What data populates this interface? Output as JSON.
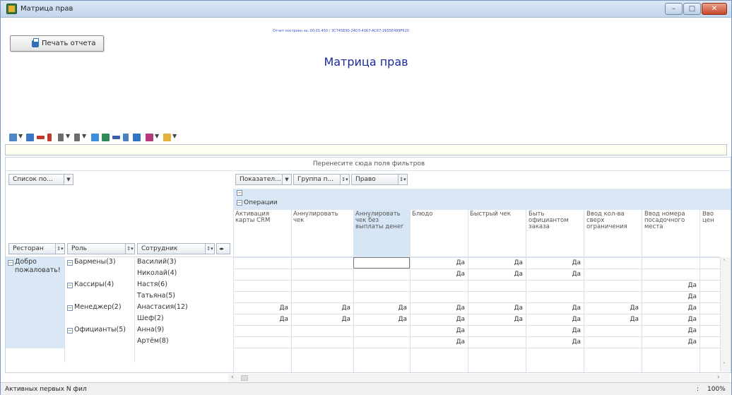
{
  "window": {
    "title": "Матрица прав"
  },
  "report": {
    "print_label": "Печать отчета",
    "meta": "Отчет построен за: 00:01.450 / 3C745E90-24D3-4167-AC67-2655E499F620",
    "title": "Матрица прав"
  },
  "pivot": {
    "drop_hint": "Перенесите сюда поля фильтров",
    "data_fields_label": "Список по...",
    "column_fields": [
      "Показател...",
      "Группа п...",
      "Право"
    ],
    "row_fields": [
      "Ресторан",
      "Роль",
      "Сотрудник"
    ],
    "group_header": "Операции",
    "columns": [
      "Активация карты CRM",
      "Аннулировать чек",
      "Аннулировать чек без выплаты денег",
      "Блюдо",
      "Быстрый чек",
      "Быть официантом заказа",
      "Ввод кол-ва сверх ограничения",
      "Ввод номера посадочного места",
      "Вво цен"
    ],
    "restaurant": "Добро пожаловать!",
    "roles": [
      {
        "name": "Бармены(3)",
        "employees": [
          "Василий(3)",
          "Николай(4)"
        ]
      },
      {
        "name": "Кассиры(4)",
        "employees": [
          "Настя(6)",
          "Татьяна(5)"
        ]
      },
      {
        "name": "Менеджер(2)",
        "employees": [
          "Анастасия(12)",
          "Шеф(2)"
        ]
      },
      {
        "name": "Официанты(5)",
        "employees": [
          "Анна(9)",
          "Артём(8)"
        ]
      }
    ],
    "yes": "Да",
    "rows": [
      [
        "",
        "",
        "",
        "Да",
        "Да",
        "Да",
        "",
        ""
      ],
      [
        "",
        "",
        "",
        "Да",
        "Да",
        "Да",
        "",
        ""
      ],
      [
        "",
        "",
        "",
        "",
        "",
        "",
        "",
        "Да"
      ],
      [
        "",
        "",
        "",
        "",
        "",
        "",
        "",
        "Да"
      ],
      [
        "Да",
        "Да",
        "Да",
        "Да",
        "Да",
        "Да",
        "Да",
        "Да"
      ],
      [
        "Да",
        "Да",
        "Да",
        "Да",
        "Да",
        "Да",
        "Да",
        "Да"
      ],
      [
        "",
        "",
        "",
        "Да",
        "",
        "Да",
        "",
        "Да"
      ],
      [
        "",
        "",
        "",
        "Да",
        "",
        "Да",
        "",
        "Да"
      ]
    ]
  },
  "status": {
    "left": "Активных первых N фил",
    "sep": ":",
    "zoom": "100%"
  }
}
